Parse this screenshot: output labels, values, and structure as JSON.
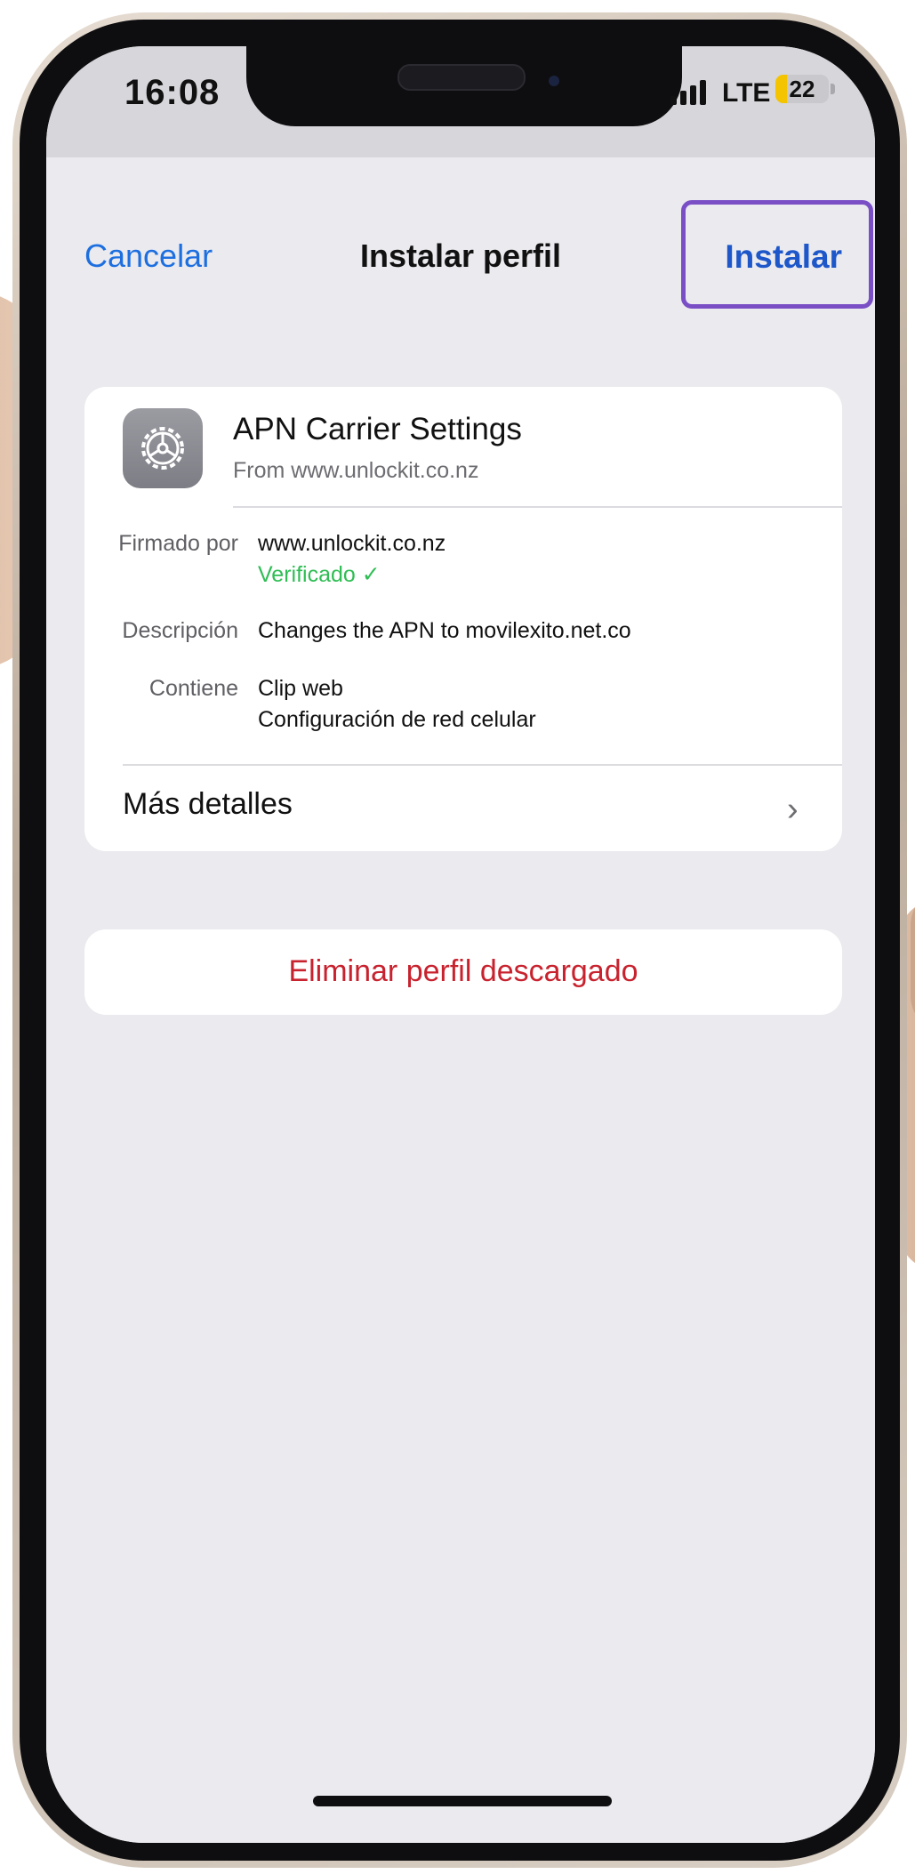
{
  "status_bar": {
    "time": "16:08",
    "network": "LTE",
    "battery": "22",
    "battery_fraction": 0.22,
    "battery_color": "#f5c400"
  },
  "nav": {
    "cancel_label": "Cancelar",
    "title": "Instalar perfil",
    "install_label": "Instalar",
    "highlight_color": "#7a4fc6"
  },
  "profile": {
    "icon": "gear-icon",
    "name": "APN Carrier Settings",
    "from": "From www.unlockit.co.nz",
    "signed_by_label": "Firmado por",
    "signed_by_value": "www.unlockit.co.nz",
    "verified_label": "Verificado ✓",
    "description_label": "Descripción",
    "description_value": "Changes the APN to movilexito.net.co",
    "contains_label": "Contiene",
    "contains_values": [
      "Clip web",
      "Configuración de red celular"
    ],
    "more_details_label": "Más detalles",
    "chevron_icon": "chevron-right-icon"
  },
  "actions": {
    "delete_label": "Eliminar perfil descargado",
    "delete_color": "#c8222e"
  },
  "colors": {
    "link_blue": "#1d6fe0",
    "verified_green": "#2fbd54",
    "background": "#eaeaef"
  }
}
